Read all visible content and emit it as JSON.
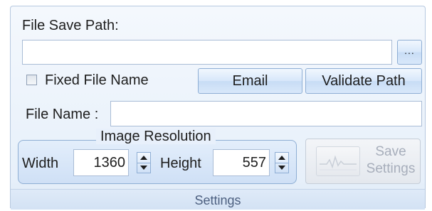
{
  "file_save": {
    "label": "File Save Path:",
    "path_value": "",
    "browse_label": "..."
  },
  "fixed_file_name": {
    "label": "Fixed File Name",
    "checked": false
  },
  "buttons": {
    "email": "Email",
    "validate": "Validate Path"
  },
  "file_name": {
    "label": "File Name :",
    "value": ""
  },
  "image_resolution": {
    "title": "Image Resolution",
    "width_label": "Width",
    "width_value": "1360",
    "height_label": "Height",
    "height_value": "557"
  },
  "save_settings": {
    "line1": "Save",
    "line2": "Settings",
    "icon": "waveform-icon"
  },
  "footer": {
    "label": "Settings"
  },
  "colors": {
    "panel_border": "#b7c9e0",
    "button_border": "#8eaed4",
    "disabled_text": "#a7aebb",
    "footer_text": "#4d6080"
  }
}
